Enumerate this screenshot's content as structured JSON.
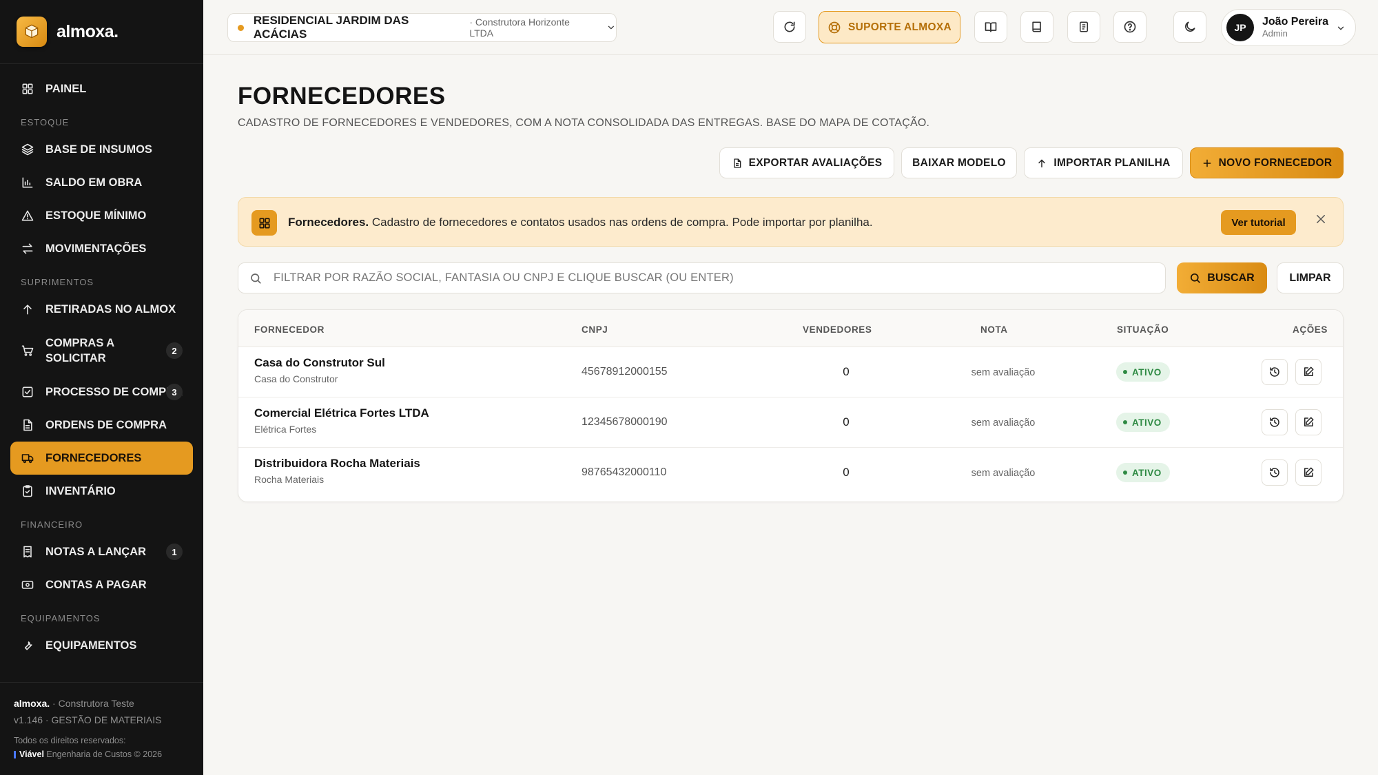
{
  "sidebar": {
    "brand": "almoxa.",
    "items": [
      {
        "type": "item",
        "label": "PAINEL",
        "icon": "grid-icon"
      },
      {
        "type": "section",
        "label": "ESTOQUE"
      },
      {
        "type": "item",
        "label": "BASE DE INSUMOS",
        "icon": "layers-icon"
      },
      {
        "type": "item",
        "label": "SALDO EM OBRA",
        "icon": "bar-chart-icon"
      },
      {
        "type": "item",
        "label": "ESTOQUE MÍNIMO",
        "icon": "warning-icon"
      },
      {
        "type": "item",
        "label": "MOVIMENTAÇÕES",
        "icon": "arrows-swap-icon"
      },
      {
        "type": "section",
        "label": "SUPRIMENTOS"
      },
      {
        "type": "item",
        "label": "RETIRADAS NO ALMOX",
        "icon": "arrow-up-icon"
      },
      {
        "type": "item",
        "label": "COMPRAS A SOLICITAR",
        "icon": "cart-icon",
        "count": "2"
      },
      {
        "type": "item",
        "label": "PROCESSO DE COMPRA",
        "icon": "checklist-icon",
        "count": "3"
      },
      {
        "type": "item",
        "label": "ORDENS DE COMPRA",
        "icon": "document-icon"
      },
      {
        "type": "item",
        "label": "FORNECEDORES",
        "icon": "truck-icon",
        "active": true
      },
      {
        "type": "item",
        "label": "INVENTÁRIO",
        "icon": "clipboard-icon"
      },
      {
        "type": "section",
        "label": "FINANCEIRO"
      },
      {
        "type": "item",
        "label": "NOTAS A LANÇAR",
        "icon": "receipt-icon",
        "count": "1"
      },
      {
        "type": "item",
        "label": "CONTAS A PAGAR",
        "icon": "banknote-icon"
      },
      {
        "type": "section",
        "label": "EQUIPAMENTOS"
      },
      {
        "type": "item",
        "label": "EQUIPAMENTOS",
        "icon": "wrench-icon"
      }
    ],
    "footer": {
      "brand": "almoxa.",
      "company": " · Construtora Teste",
      "version": "v1.146 · GESTÃO DE MATERIAIS",
      "rights": "Todos os direitos reservados:",
      "maker": "Viável",
      "maker_suffix": " Engenharia de Custos © 2026"
    }
  },
  "topbar": {
    "project_name": "RESIDENCIAL JARDIM DAS ACÁCIAS",
    "project_company": "· Construtora Horizonte LTDA",
    "support_label": "SUPORTE ALMOXA",
    "user_initials": "JP",
    "user_name": "João Pereira",
    "user_role": "Admin"
  },
  "page": {
    "title": "FORNECEDORES",
    "subtitle": "CADASTRO DE FORNECEDORES E VENDEDORES, COM A NOTA CONSOLIDADA DAS ENTREGAS. BASE DO MAPA DE COTAÇÃO.",
    "actions": {
      "export": "EXPORTAR AVALIAÇÕES",
      "template": "BAIXAR MODELO",
      "import": "IMPORTAR PLANILHA",
      "new": "NOVO FORNECEDOR"
    },
    "banner": {
      "title": "Fornecedores.",
      "text": " Cadastro de fornecedores e contatos usados nas ordens de compra. Pode importar por planilha.",
      "button": "Ver tutorial"
    },
    "search": {
      "placeholder": "FILTRAR POR RAZÃO SOCIAL, FANTASIA OU CNPJ E CLIQUE BUSCAR (OU ENTER)",
      "button": "BUSCAR",
      "clear": "LIMPAR"
    },
    "table": {
      "headers": {
        "supplier": "FORNECEDOR",
        "cnpj": "CNPJ",
        "sellers": "VENDEDORES",
        "rating": "NOTA",
        "status": "SITUAÇÃO",
        "actions": "AÇÕES"
      },
      "rows": [
        {
          "name": "Casa do Construtor Sul",
          "fantasy": "Casa do Construtor",
          "cnpj": "45678912000155",
          "sellers": "0",
          "rating": "sem avaliação",
          "status": "ATIVO"
        },
        {
          "name": "Comercial Elétrica Fortes LTDA",
          "fantasy": "Elétrica Fortes",
          "cnpj": "12345678000190",
          "sellers": "0",
          "rating": "sem avaliação",
          "status": "ATIVO"
        },
        {
          "name": "Distribuidora Rocha Materiais",
          "fantasy": "Rocha Materiais",
          "cnpj": "98765432000110",
          "sellers": "0",
          "rating": "sem avaliação",
          "status": "ATIVO"
        }
      ]
    }
  },
  "colors": {
    "accent": "#e59a20",
    "sidebar_bg": "#141414",
    "status_active": "#2e8a43",
    "page_bg": "#f7f6f3"
  }
}
